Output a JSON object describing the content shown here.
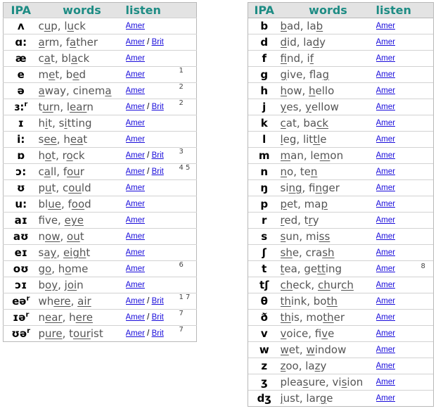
{
  "headers": {
    "ipa": "IPA",
    "words": "words",
    "listen": "listen"
  },
  "link_labels": {
    "amer": "Amer",
    "brit": "Brit",
    "separator": " / "
  },
  "colors": {
    "header_text": "#1e8c84",
    "header_bg": "#e3e3e3",
    "link": "#1a0ddb",
    "words_text": "#555555"
  },
  "left": [
    {
      "ipa": "ʌ",
      "ipa_sup": "",
      "words": [
        [
          "c",
          "u",
          "p, l",
          "u",
          "ck"
        ]
      ],
      "brit": false,
      "note": ""
    },
    {
      "ipa": "ɑ:",
      "ipa_sup": "",
      "words": [
        [
          "",
          "a",
          "rm, f",
          "a",
          "ther"
        ]
      ],
      "brit": true,
      "note": ""
    },
    {
      "ipa": "æ",
      "ipa_sup": "",
      "words": [
        [
          "c",
          "a",
          "t, bl",
          "a",
          "ck"
        ]
      ],
      "brit": false,
      "note": ""
    },
    {
      "ipa": "e",
      "ipa_sup": "",
      "words": [
        [
          "m",
          "e",
          "t, b",
          "e",
          "d"
        ]
      ],
      "brit": false,
      "note": "1"
    },
    {
      "ipa": "ə",
      "ipa_sup": "",
      "words": [
        [
          "",
          "a",
          "way, cinem",
          "a",
          ""
        ]
      ],
      "brit": false,
      "note": "2"
    },
    {
      "ipa": "ɜ:",
      "ipa_sup": "r",
      "words": [
        [
          "t",
          "ur",
          "n, l",
          "ear",
          "n"
        ]
      ],
      "brit": true,
      "note": "2"
    },
    {
      "ipa": "ɪ",
      "ipa_sup": "",
      "words": [
        [
          "h",
          "i",
          "t, s",
          "i",
          "tting"
        ]
      ],
      "brit": false,
      "note": ""
    },
    {
      "ipa": "i:",
      "ipa_sup": "",
      "words": [
        [
          "s",
          "ee",
          ", h",
          "ea",
          "t"
        ]
      ],
      "brit": false,
      "note": ""
    },
    {
      "ipa": "ɒ",
      "ipa_sup": "",
      "words": [
        [
          "h",
          "o",
          "t, r",
          "o",
          "ck"
        ]
      ],
      "brit": true,
      "note": "3"
    },
    {
      "ipa": "ɔ:",
      "ipa_sup": "",
      "words": [
        [
          "c",
          "a",
          "ll, f",
          "ou",
          "r"
        ]
      ],
      "brit": true,
      "note": "4 5"
    },
    {
      "ipa": "ʊ",
      "ipa_sup": "",
      "words": [
        [
          "p",
          "u",
          "t, c",
          "ou",
          "ld"
        ]
      ],
      "brit": false,
      "note": ""
    },
    {
      "ipa": "u:",
      "ipa_sup": "",
      "words": [
        [
          "bl",
          "ue",
          ", f",
          "oo",
          "d"
        ]
      ],
      "brit": false,
      "note": ""
    },
    {
      "ipa": "aɪ",
      "ipa_sup": "",
      "words": [
        [
          "f",
          "i",
          "ve, ",
          "eye",
          ""
        ]
      ],
      "brit": false,
      "note": ""
    },
    {
      "ipa": "aʊ",
      "ipa_sup": "",
      "words": [
        [
          "n",
          "ow",
          ", ",
          "ou",
          "t"
        ]
      ],
      "brit": false,
      "note": ""
    },
    {
      "ipa": "eɪ",
      "ipa_sup": "",
      "words": [
        [
          "s",
          "ay",
          ", ",
          "eigh",
          "t"
        ]
      ],
      "brit": false,
      "note": ""
    },
    {
      "ipa": "oʊ",
      "ipa_sup": "",
      "words": [
        [
          "g",
          "o",
          ", h",
          "o",
          "me"
        ]
      ],
      "brit": false,
      "note": "6"
    },
    {
      "ipa": "ɔɪ",
      "ipa_sup": "",
      "words": [
        [
          "b",
          "oy",
          ", j",
          "oi",
          "n"
        ]
      ],
      "brit": false,
      "note": ""
    },
    {
      "ipa": "eə",
      "ipa_sup": "r",
      "words": [
        [
          "wh",
          "ere",
          ", ",
          "air",
          ""
        ]
      ],
      "brit": true,
      "note": "1 7"
    },
    {
      "ipa": "ɪə",
      "ipa_sup": "r",
      "words": [
        [
          "n",
          "ear",
          ", h",
          "ere",
          ""
        ]
      ],
      "brit": true,
      "note": "7"
    },
    {
      "ipa": "ʊə",
      "ipa_sup": "r",
      "words": [
        [
          "p",
          "ure",
          ", t",
          "our",
          "ist"
        ]
      ],
      "brit": true,
      "note": "7"
    }
  ],
  "right": [
    {
      "ipa": "b",
      "words": [
        [
          "",
          "b",
          "ad, la",
          "b",
          ""
        ]
      ],
      "note": ""
    },
    {
      "ipa": "d",
      "words": [
        [
          "",
          "d",
          "id, la",
          "d",
          "y"
        ]
      ],
      "note": ""
    },
    {
      "ipa": "f",
      "words": [
        [
          "",
          "f",
          "ind, i",
          "f",
          ""
        ]
      ],
      "note": ""
    },
    {
      "ipa": "g",
      "words": [
        [
          "",
          "g",
          "ive, fla",
          "g",
          ""
        ]
      ],
      "note": ""
    },
    {
      "ipa": "h",
      "words": [
        [
          "",
          "h",
          "ow, ",
          "h",
          "ello"
        ]
      ],
      "note": ""
    },
    {
      "ipa": "j",
      "words": [
        [
          "",
          "y",
          "es, ",
          "y",
          "ellow"
        ]
      ],
      "note": ""
    },
    {
      "ipa": "k",
      "words": [
        [
          "",
          "c",
          "at, ba",
          "ck",
          ""
        ]
      ],
      "note": ""
    },
    {
      "ipa": "l",
      "words": [
        [
          "",
          "l",
          "eg, lit",
          "tl",
          "e"
        ]
      ],
      "note": ""
    },
    {
      "ipa": "m",
      "words": [
        [
          "",
          "m",
          "an, le",
          "m",
          "on"
        ]
      ],
      "note": ""
    },
    {
      "ipa": "n",
      "words": [
        [
          "",
          "n",
          "o, te",
          "n",
          ""
        ]
      ],
      "note": ""
    },
    {
      "ipa": "ŋ",
      "words": [
        [
          "si",
          "ng",
          ", fi",
          "n",
          "ger"
        ]
      ],
      "note": ""
    },
    {
      "ipa": "p",
      "words": [
        [
          "",
          "p",
          "et, ma",
          "p",
          ""
        ]
      ],
      "note": ""
    },
    {
      "ipa": "r",
      "words": [
        [
          "",
          "r",
          "ed, t",
          "r",
          "y"
        ]
      ],
      "note": ""
    },
    {
      "ipa": "s",
      "words": [
        [
          "",
          "s",
          "un, mi",
          "ss",
          ""
        ]
      ],
      "note": ""
    },
    {
      "ipa": "ʃ",
      "words": [
        [
          "",
          "sh",
          "e, cra",
          "sh",
          ""
        ]
      ],
      "note": ""
    },
    {
      "ipa": "t",
      "words": [
        [
          "",
          "t",
          "ea, ge",
          "tt",
          "ing"
        ]
      ],
      "note": "8"
    },
    {
      "ipa": "tʃ",
      "words": [
        [
          "",
          "ch",
          "eck, ",
          "ch",
          "ur"
        ],
        [
          "",
          "ch",
          ""
        ]
      ],
      "note": ""
    },
    {
      "ipa": "θ",
      "words": [
        [
          "",
          "th",
          "ink, bo",
          "th",
          ""
        ]
      ],
      "note": ""
    },
    {
      "ipa": "ð",
      "words": [
        [
          "",
          "th",
          "is, mo",
          "th",
          "er"
        ]
      ],
      "note": ""
    },
    {
      "ipa": "v",
      "words": [
        [
          "",
          "v",
          "oice, fi",
          "v",
          "e"
        ]
      ],
      "note": ""
    },
    {
      "ipa": "w",
      "words": [
        [
          "",
          "w",
          "et, ",
          "w",
          "indow"
        ]
      ],
      "note": ""
    },
    {
      "ipa": "z",
      "words": [
        [
          "",
          "z",
          "oo, la",
          "z",
          "y"
        ]
      ],
      "note": ""
    },
    {
      "ipa": "ʒ",
      "words": [
        [
          "plea",
          "s",
          "ure, vi",
          "s",
          "ion"
        ]
      ],
      "note": ""
    },
    {
      "ipa": "dʒ",
      "words": [
        [
          "",
          "j",
          "ust, lar",
          "g",
          "e"
        ]
      ],
      "note": ""
    }
  ]
}
